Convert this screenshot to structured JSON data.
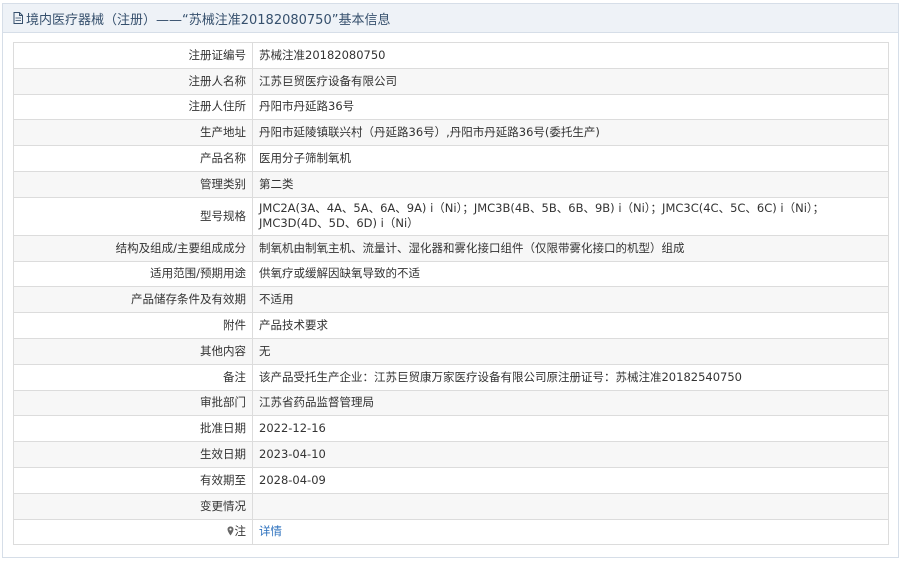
{
  "header": {
    "title": "境内医疗器械（注册）——“苏械注准20182080750”基本信息"
  },
  "rows": [
    {
      "label": "注册证编号",
      "value": "苏械注准20182080750"
    },
    {
      "label": "注册人名称",
      "value": "江苏巨贸医疗设备有限公司"
    },
    {
      "label": "注册人住所",
      "value": "丹阳市丹延路36号"
    },
    {
      "label": "生产地址",
      "value": "丹阳市延陵镇联兴村（丹延路36号）,丹阳市丹延路36号(委托生产)"
    },
    {
      "label": "产品名称",
      "value": "医用分子筛制氧机"
    },
    {
      "label": "管理类别",
      "value": "第二类"
    },
    {
      "label": "型号规格",
      "value": "JMC2A(3A、4A、5A、6A、9A) i（Ni）；JMC3B(4B、5B、6B、9B) i（Ni）；JMC3C(4C、5C、6C) i（Ni）；JMC3D(4D、5D、6D) i（Ni）"
    },
    {
      "label": "结构及组成/主要组成成分",
      "value": "制氧机由制氧主机、流量计、湿化器和雾化接口组件（仅限带雾化接口的机型）组成"
    },
    {
      "label": "适用范围/预期用途",
      "value": "供氧疗或缓解因缺氧导致的不适"
    },
    {
      "label": "产品储存条件及有效期",
      "value": "不适用"
    },
    {
      "label": "附件",
      "value": "产品技术要求"
    },
    {
      "label": "其他内容",
      "value": "无"
    },
    {
      "label": "备注",
      "value": "该产品受托生产企业：江苏巨贸康万家医疗设备有限公司原注册证号：苏械注准20182540750"
    },
    {
      "label": "审批部门",
      "value": "江苏省药品监督管理局"
    },
    {
      "label": "批准日期",
      "value": "2022-12-16"
    },
    {
      "label": "生效日期",
      "value": "2023-04-10"
    },
    {
      "label": "有效期至",
      "value": "2028-04-09"
    },
    {
      "label": "变更情况",
      "value": ""
    },
    {
      "label": "注",
      "value": "详情",
      "icon": "pin-icon"
    }
  ]
}
